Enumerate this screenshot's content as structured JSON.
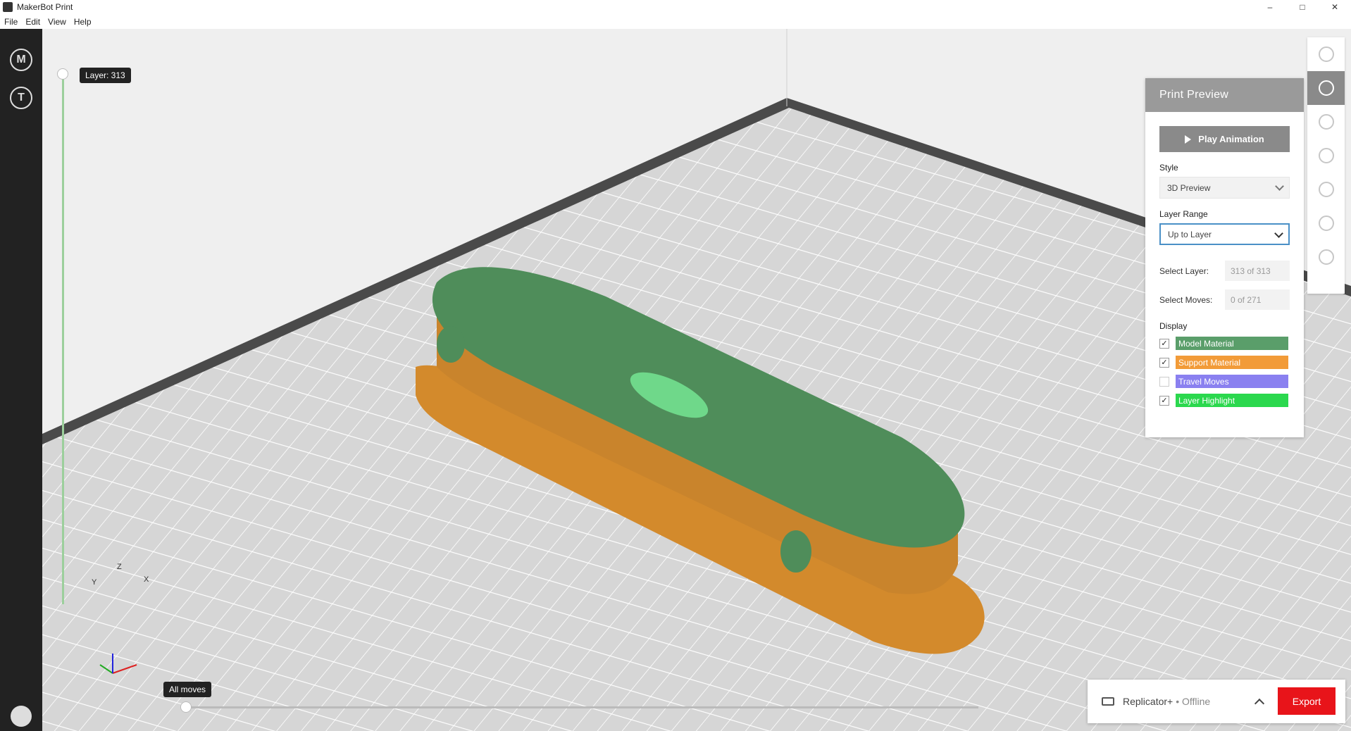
{
  "window": {
    "title": "MakerBot Print",
    "controls": [
      "–",
      "□",
      "✕"
    ]
  },
  "menu": [
    "File",
    "Edit",
    "View",
    "Help"
  ],
  "left_sidebar": {
    "items": [
      {
        "icon": "makerbot-logo-icon",
        "glyph": "M"
      },
      {
        "icon": "thingiverse-icon",
        "glyph": "T"
      }
    ]
  },
  "viewport": {
    "layer_tooltip": "Layer: 313",
    "moves_tooltip": "All moves",
    "axes": {
      "x": "X",
      "y": "Y",
      "z": "Z"
    }
  },
  "print_preview": {
    "title": "Print Preview",
    "play_label": "Play Animation",
    "style_label": "Style",
    "style_value": "3D Preview",
    "layer_range_label": "Layer Range",
    "layer_range_value": "Up to Layer",
    "select_layer_label": "Select Layer:",
    "select_layer_value": "313 of 313",
    "select_moves_label": "Select Moves:",
    "select_moves_value": "0 of 271",
    "display_label": "Display",
    "display_items": [
      {
        "label": "Model Material",
        "checked": true,
        "color": "#5a9e6a"
      },
      {
        "label": "Support Material",
        "checked": true,
        "color": "#f29b38"
      },
      {
        "label": "Travel Moves",
        "checked": false,
        "color": "#8a80f0"
      },
      {
        "label": "Layer Highlight",
        "checked": true,
        "color": "#2bd84e"
      }
    ]
  },
  "right_rail": [
    "preview-sphere-icon",
    "layers-icon",
    "info-icon",
    "settings-icon",
    "arrange-icon",
    "rotate-icon",
    "scale-icon"
  ],
  "bottom": {
    "printer_name": "Replicator+",
    "printer_status": "• Offline",
    "export_label": "Export"
  },
  "colors": {
    "model": "#4f8d5a",
    "support": "#d9953a",
    "accent": "#e8141a"
  }
}
